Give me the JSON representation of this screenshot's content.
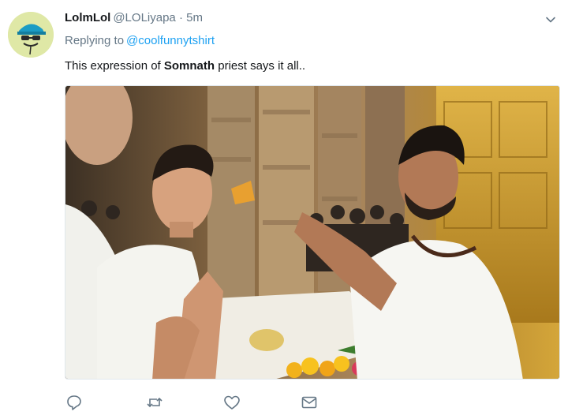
{
  "tweet": {
    "display_name": "LolmLol",
    "handle": "@LOLiyapa",
    "separator": "·",
    "time": "5m",
    "replying_prefix": "Replying to",
    "replying_to": "@coolfunnytshirt",
    "text_before": "This expression of ",
    "text_bold": "Somnath",
    "text_after": " priest says it all.."
  },
  "icons": {
    "caret": "chevron-down-icon",
    "reply": "reply-icon",
    "retweet": "retweet-icon",
    "like": "heart-icon",
    "dm": "envelope-icon"
  },
  "colors": {
    "link": "#1da1f2",
    "secondary_text": "#657786",
    "primary_text": "#14171a",
    "avatar_bg": "#dfe8a6"
  }
}
